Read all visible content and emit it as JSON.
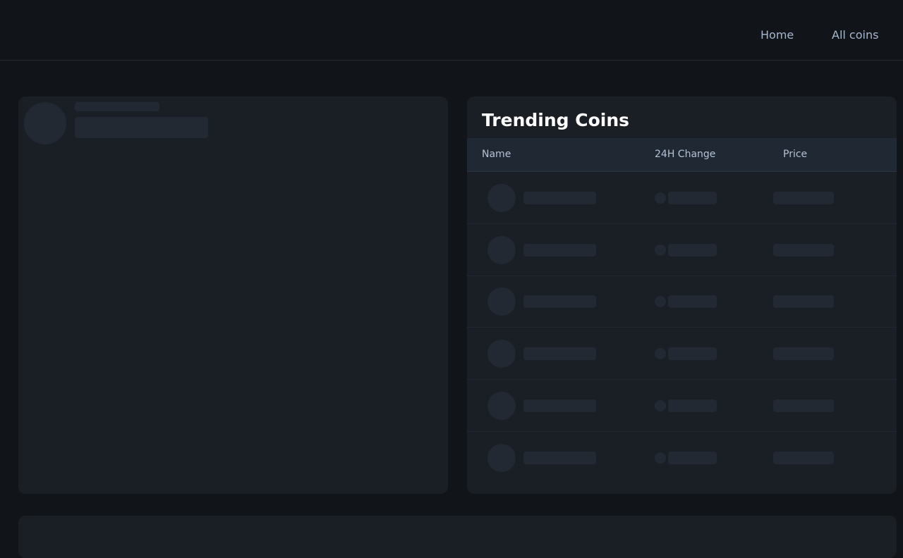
{
  "nav": {
    "home_label": "Home",
    "all_coins_label": "All coins"
  },
  "trending": {
    "title": "Trending Coins",
    "columns": [
      "Name",
      "24H Change",
      "Price"
    ],
    "rows_loading": 6
  },
  "colors": {
    "background": "#111418",
    "panel": "#1a1f26",
    "skeleton": "#222933",
    "table_header": "#202833",
    "nav_text": "#a6b8d0"
  }
}
